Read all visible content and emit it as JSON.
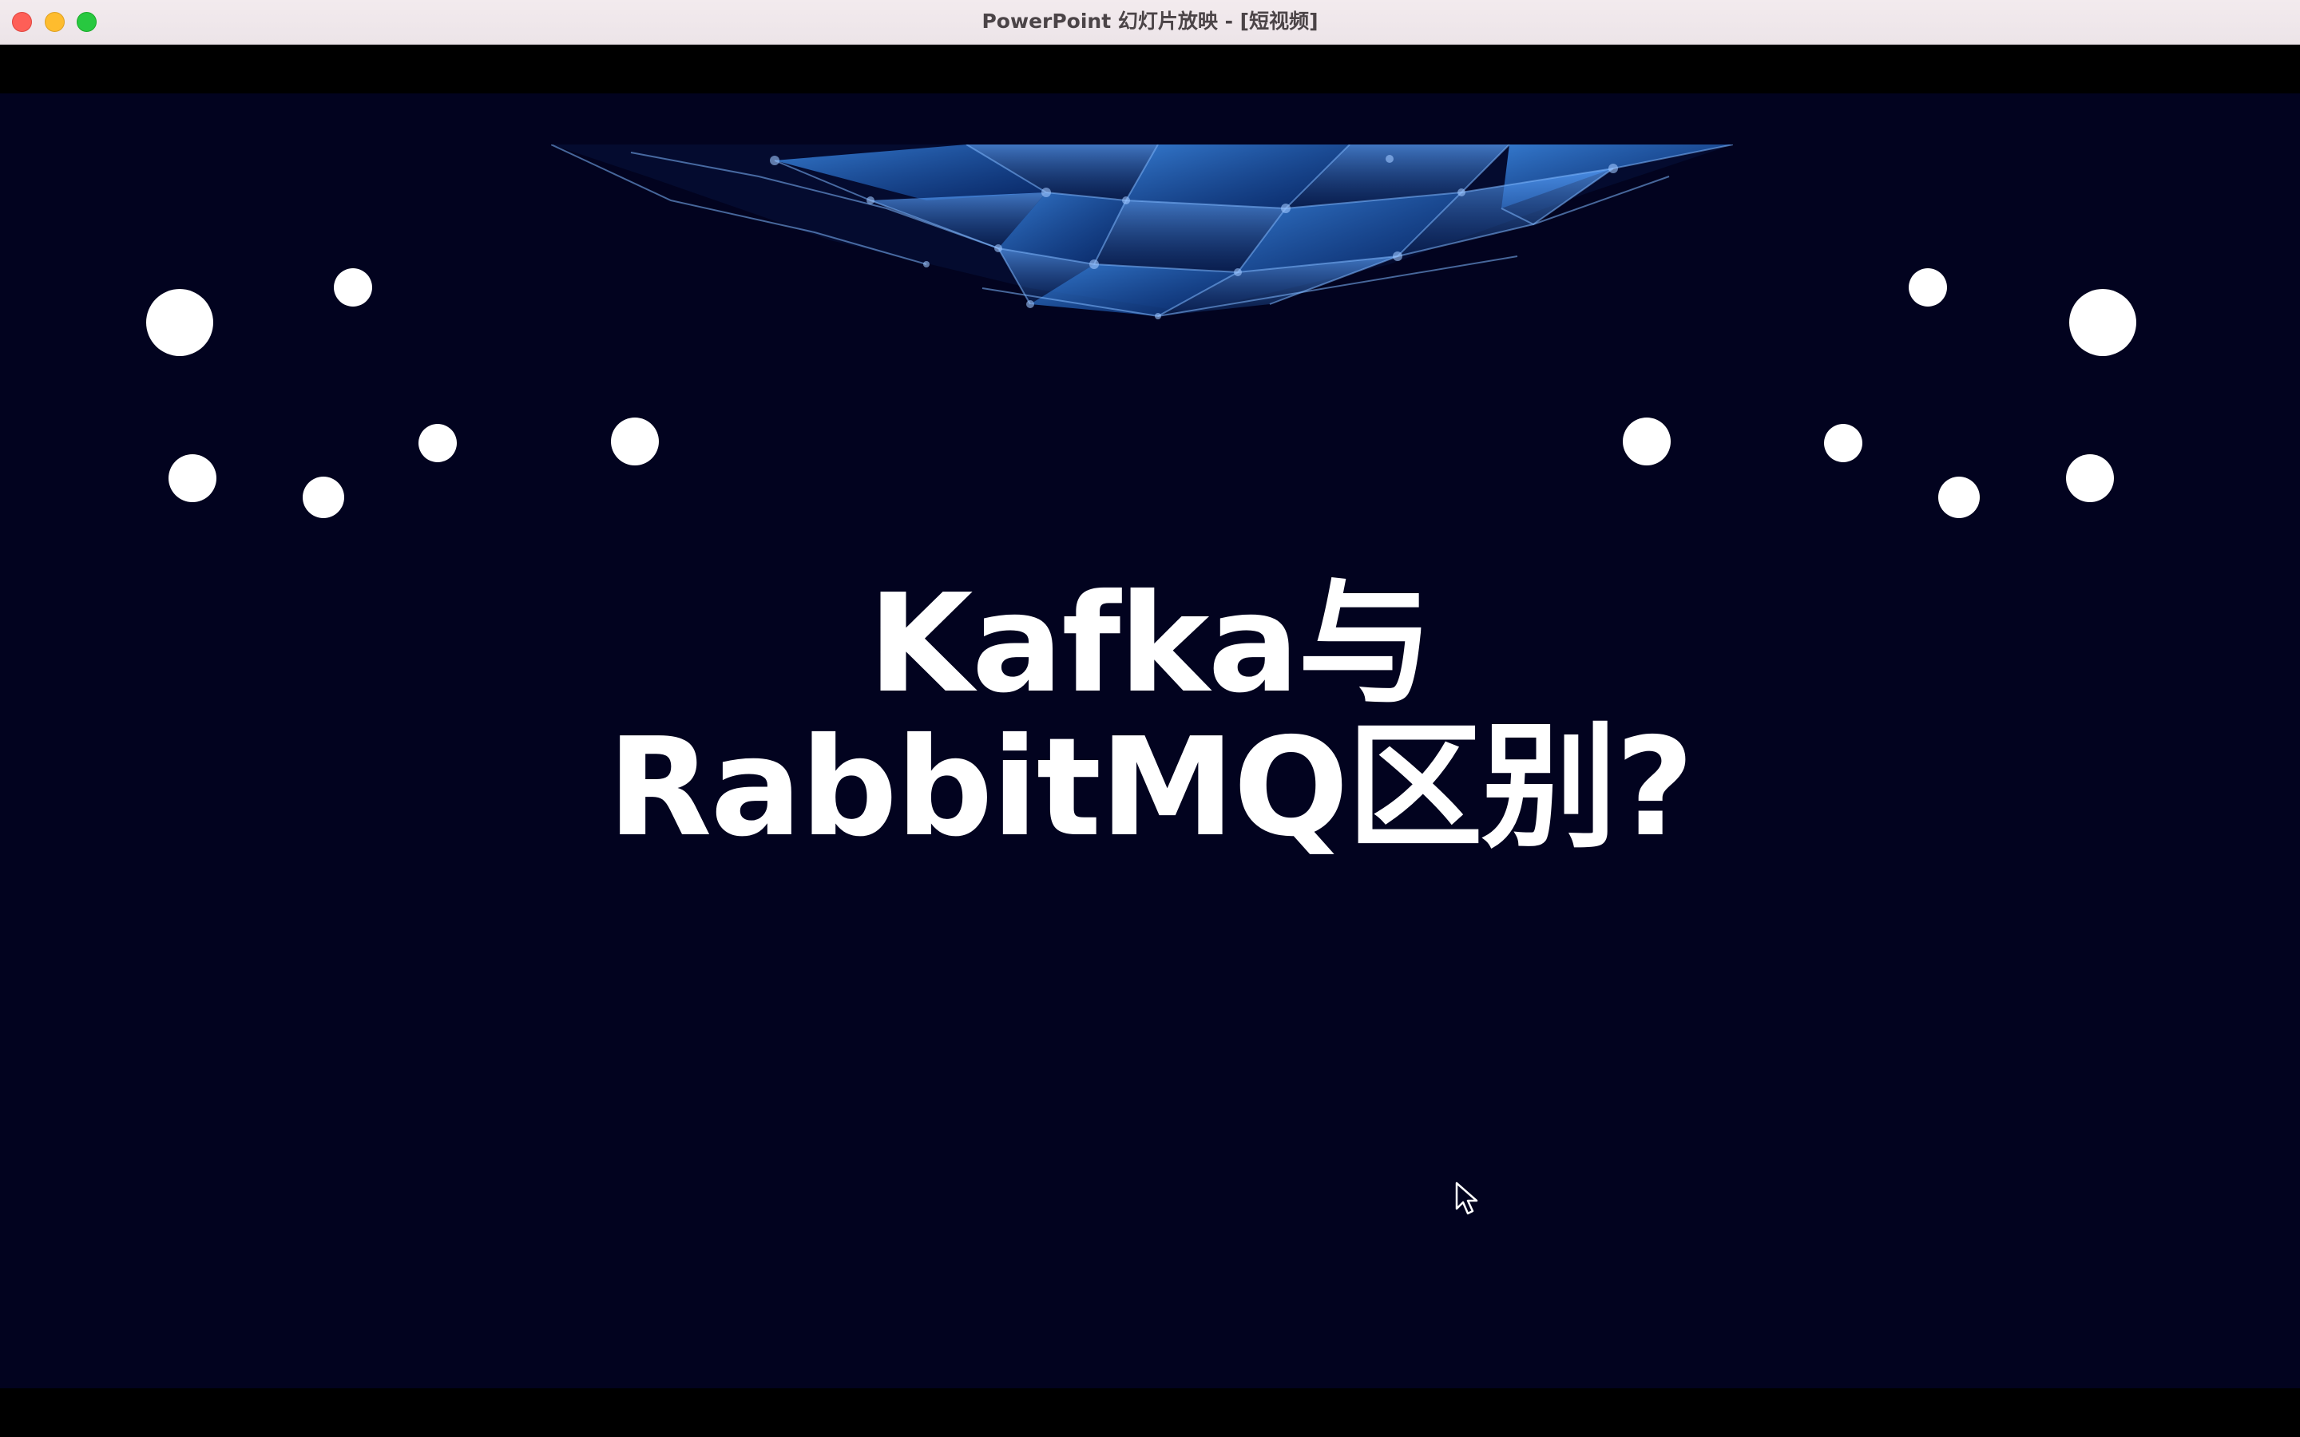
{
  "window": {
    "title": "PowerPoint 幻灯片放映 - [短视频]",
    "controls": [
      "close",
      "minimize",
      "zoom"
    ]
  },
  "slide": {
    "title_line1": "Kafka与",
    "title_line2": "RabbitMQ区别?",
    "background_color": "#02031f",
    "text_color": "#ffffff",
    "decoration": "blue-polygon-network",
    "dot_color": "#ffffff"
  },
  "cursor": {
    "icon": "arrow-pointer-icon"
  }
}
